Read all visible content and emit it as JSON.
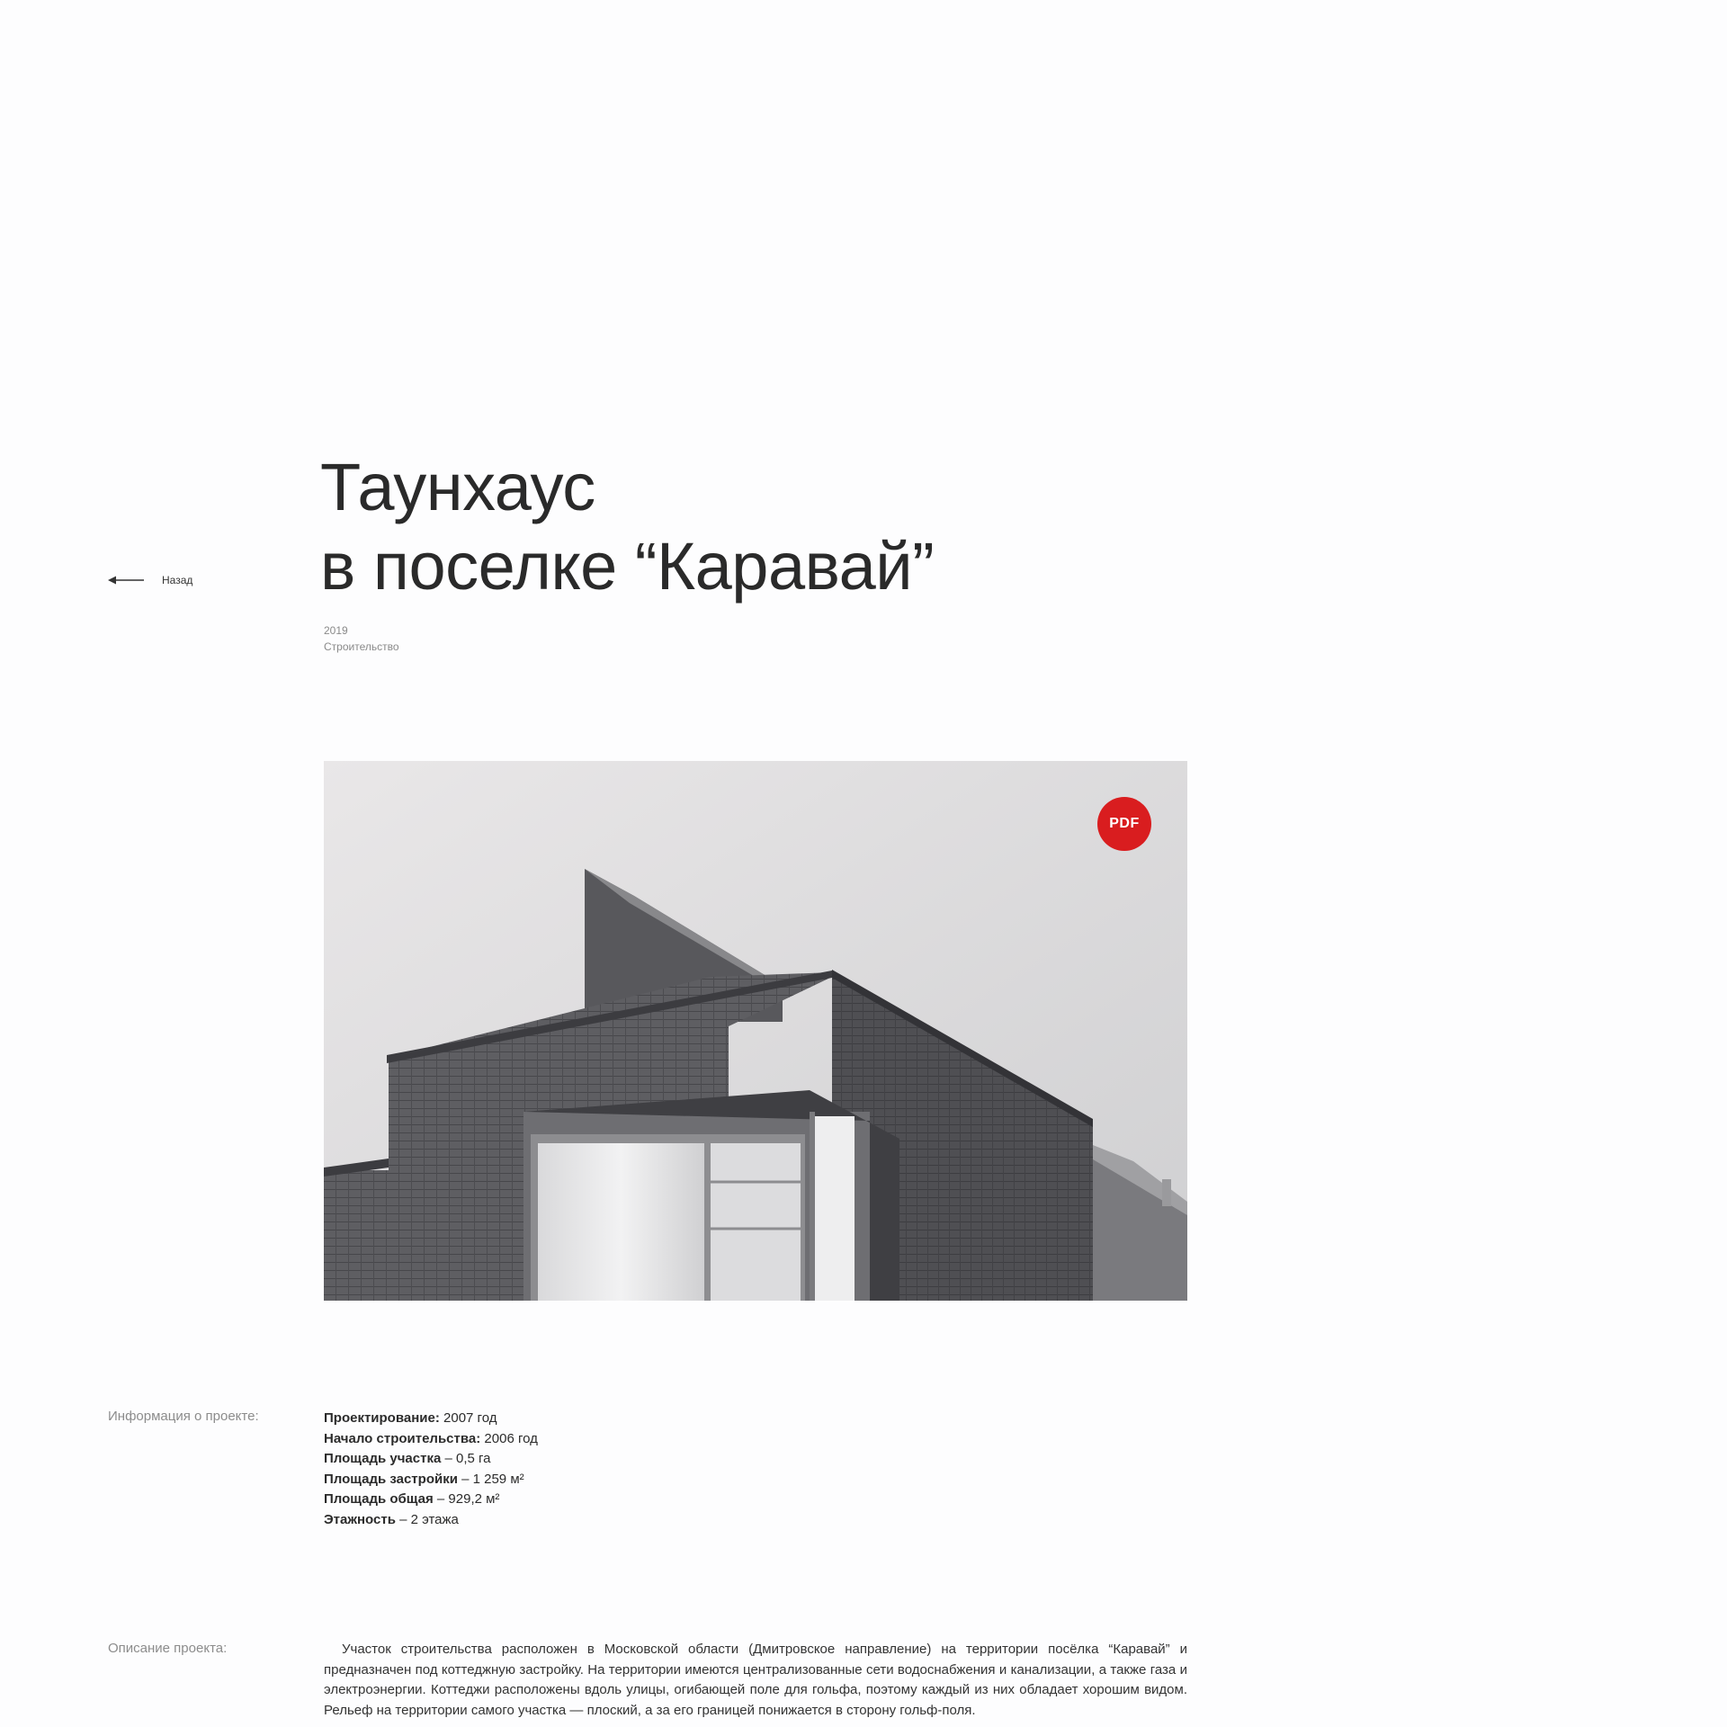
{
  "nav": {
    "back_label": "Назад"
  },
  "project": {
    "title_line1": "Таунхаус",
    "title_line2": "в поселке “Каравай”",
    "year": "2019",
    "category": "Строительство"
  },
  "photo": {
    "pdf_label": "PDF"
  },
  "info": {
    "section_label": "Информация о проекте:",
    "items": [
      {
        "label": "Проектирование:",
        "value": " 2007 год"
      },
      {
        "label": "Начало строительства:",
        "value": " 2006 год"
      },
      {
        "label": "Площадь участка",
        "value": " – 0,5 га"
      },
      {
        "label": "Площадь застройки",
        "value": " – 1 259 м²"
      },
      {
        "label": "Площадь общая",
        "value": " – 929,2 м²"
      },
      {
        "label": "Этажность",
        "value": " – 2 этажа"
      }
    ]
  },
  "description": {
    "section_label": "Описание проекта:",
    "text": "Участок строительства расположен в Московской области (Дмитровское направление) на территории посёлка “Каравай” и предназначен под коттеджную застройку. На территории имеются централизованные сети водоснабжения и канализации, а также газа и электроэнергии. Коттеджи расположены вдоль улицы, огибающей поле для гольфа, поэтому каждый из них обладает хорошим видом. Рельеф на территории самого участка — плоский, а за его границей понижается в сторону гольф-поля."
  },
  "colors": {
    "accent": "#d91d1f",
    "text": "#2b2b2b",
    "muted": "#8c8c8c"
  },
  "icons": {
    "back": "arrow-left-icon"
  }
}
